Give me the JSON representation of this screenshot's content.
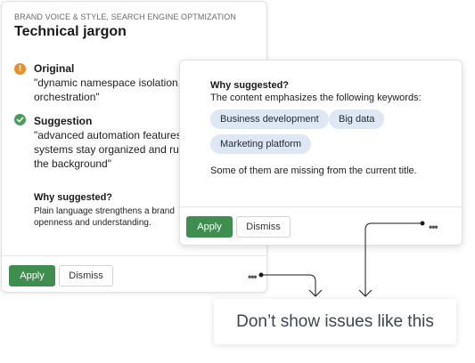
{
  "back_card": {
    "category": "BRAND VOICE & STYLE, SEARCH ENGINE OPTMIZATION",
    "title": "Technical jargon",
    "original": {
      "label": "Original",
      "lines": [
        "\"dynamic namespace isolation,",
        "orchestration\""
      ]
    },
    "suggestion": {
      "label": "Suggestion",
      "lines": [
        "\"advanced automation features",
        "systems stay organized and run",
        "the background\""
      ]
    },
    "why": {
      "label": "Why suggested?",
      "lines": [
        "Plain language strengthens a brand",
        "openness and understanding."
      ]
    },
    "apply_label": "Apply",
    "dismiss_label": "Dismiss",
    "more_label": "•••"
  },
  "front_card": {
    "why_label": "Why suggested?",
    "description": "The content emphasizes the following keywords:",
    "keywords": [
      "Business development",
      "Big data",
      "Marketing platform"
    ],
    "missing_note": "Some of them are missing from the current title.",
    "apply_label": "Apply",
    "dismiss_label": "Dismiss",
    "more_label": "•••"
  },
  "tooltip": {
    "text": "Don’t show issues like this"
  },
  "colors": {
    "apply_green": "#3f8e50",
    "warning_orange": "#e8902b",
    "check_green": "#4c9a5c",
    "chip_blue": "#dde8f4"
  },
  "icons": {
    "original": "warning-icon",
    "suggestion": "check-icon",
    "more": "more-dots-icon"
  }
}
